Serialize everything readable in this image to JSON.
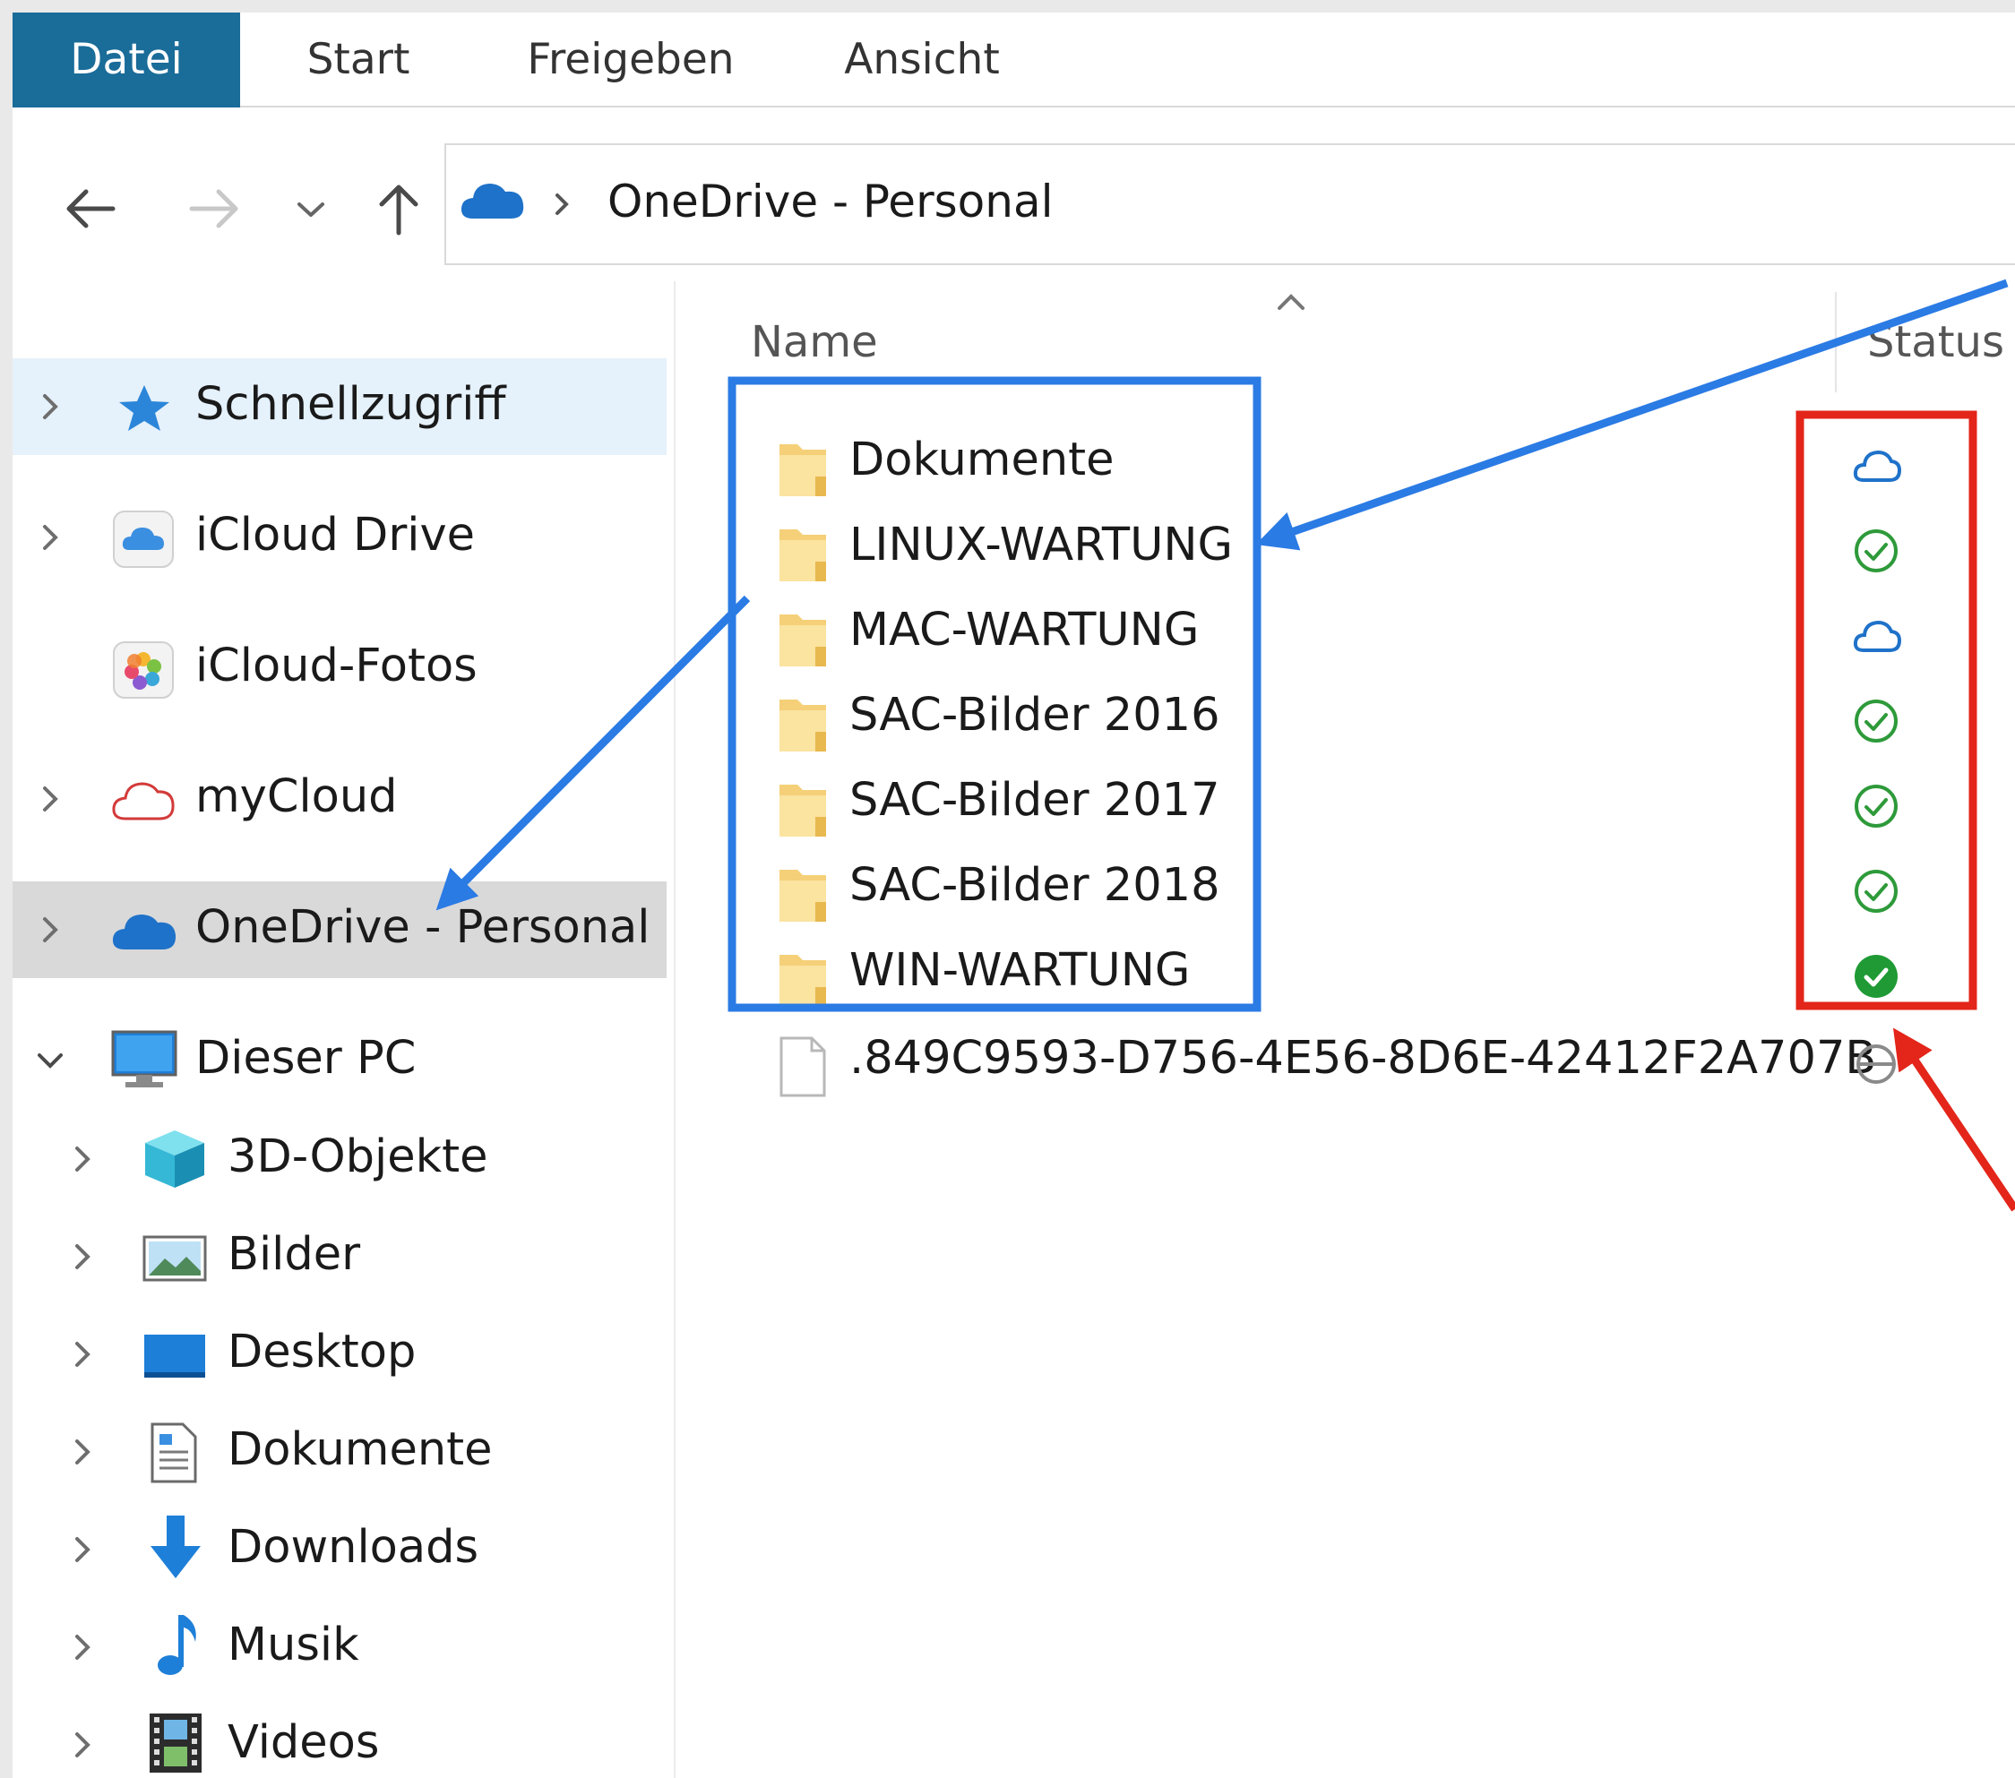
{
  "ribbon": {
    "tabs": [
      {
        "label": "Datei",
        "active": true
      },
      {
        "label": "Start",
        "active": false
      },
      {
        "label": "Freigeben",
        "active": false
      },
      {
        "label": "Ansicht",
        "active": false
      }
    ]
  },
  "address": {
    "path": "OneDrive - Personal",
    "icon": "onedrive-cloud-icon"
  },
  "sidebar": {
    "items": [
      {
        "label": "Schnellzugriff",
        "icon": "quick-access-star-icon",
        "expanded": false,
        "highlight": "hover"
      },
      {
        "label": "iCloud Drive",
        "icon": "icloud-drive-icon",
        "expanded": false
      },
      {
        "label": "iCloud-Fotos",
        "icon": "icloud-photos-icon"
      },
      {
        "label": "myCloud",
        "icon": "mycloud-icon",
        "expanded": false
      },
      {
        "label": "OneDrive - Personal",
        "icon": "onedrive-icon",
        "expanded": false,
        "highlight": "selected"
      },
      {
        "label": "Dieser PC",
        "icon": "this-pc-icon",
        "expanded": true
      },
      {
        "label": "3D-Objekte",
        "icon": "3d-objects-icon"
      },
      {
        "label": "Bilder",
        "icon": "pictures-icon"
      },
      {
        "label": "Desktop",
        "icon": "desktop-icon"
      },
      {
        "label": "Dokumente",
        "icon": "documents-icon"
      },
      {
        "label": "Downloads",
        "icon": "downloads-icon"
      },
      {
        "label": "Musik",
        "icon": "music-icon"
      },
      {
        "label": "Videos",
        "icon": "videos-icon"
      }
    ]
  },
  "list": {
    "columns": {
      "name": "Name",
      "status": "Status"
    },
    "rows": [
      {
        "name": "Dokumente",
        "type": "folder",
        "status": "cloud-only"
      },
      {
        "name": "LINUX-WARTUNG",
        "type": "folder",
        "status": "available-locally"
      },
      {
        "name": "MAC-WARTUNG",
        "type": "folder",
        "status": "cloud-only"
      },
      {
        "name": "SAC-Bilder 2016",
        "type": "folder",
        "status": "available-locally"
      },
      {
        "name": "SAC-Bilder 2017",
        "type": "folder",
        "status": "available-locally"
      },
      {
        "name": "SAC-Bilder 2018",
        "type": "folder",
        "status": "available-locally"
      },
      {
        "name": "WIN-WARTUNG",
        "type": "folder",
        "status": "always-keep"
      },
      {
        "name": ".849C9593-D756-4E56-8D6E-42412F2A707B",
        "type": "file",
        "status": "excluded"
      }
    ]
  },
  "colors": {
    "ribbon_active": "#1a6c99",
    "annotation_blue": "#2b7be4",
    "annotation_red": "#e3251a",
    "status_green": "#2e9a3a",
    "status_cloud": "#1f72c9"
  }
}
